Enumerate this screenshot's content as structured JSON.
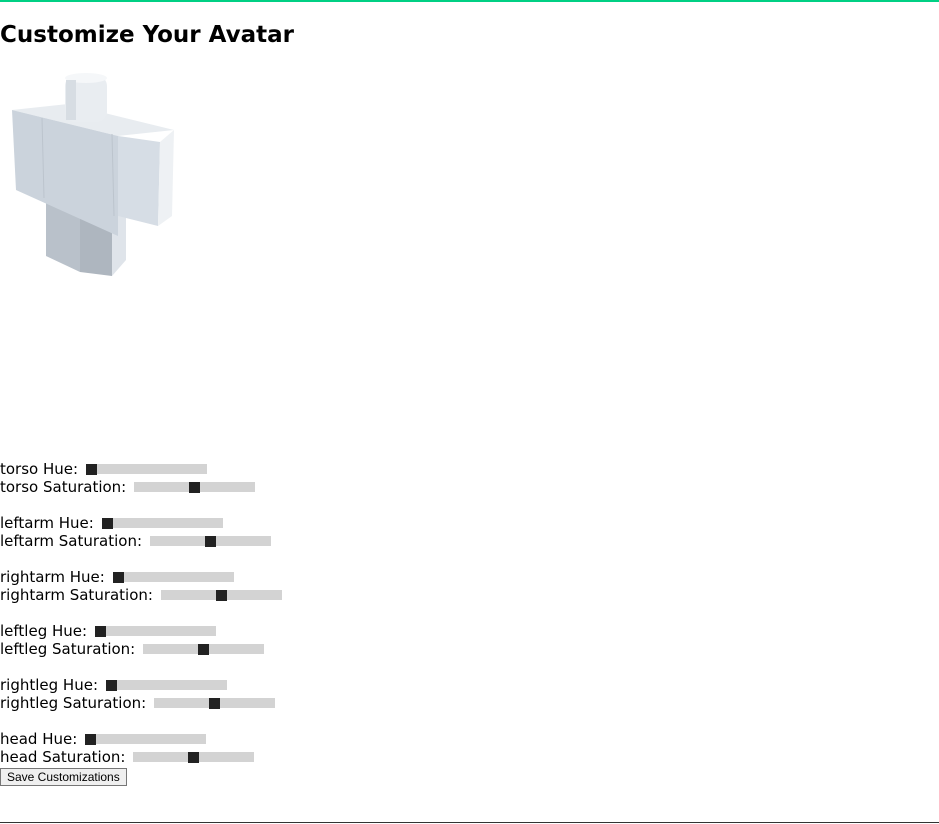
{
  "page": {
    "title": "Customize Your Avatar",
    "accent_color": "#00d084"
  },
  "avatar": {
    "body_color": "#cfd6de"
  },
  "parts": [
    {
      "id": "torso",
      "hue_label": "torso Hue:",
      "sat_label": "torso Saturation:",
      "hue": 0.0,
      "saturation": 0.5
    },
    {
      "id": "leftarm",
      "hue_label": "leftarm Hue:",
      "sat_label": "leftarm Saturation:",
      "hue": 0.0,
      "saturation": 0.5
    },
    {
      "id": "rightarm",
      "hue_label": "rightarm Hue:",
      "sat_label": "rightarm Saturation:",
      "hue": 0.0,
      "saturation": 0.5
    },
    {
      "id": "leftleg",
      "hue_label": "leftleg Hue:",
      "sat_label": "leftleg Saturation:",
      "hue": 0.0,
      "saturation": 0.5
    },
    {
      "id": "rightleg",
      "hue_label": "rightleg Hue:",
      "sat_label": "rightleg Saturation:",
      "hue": 0.0,
      "saturation": 0.5
    },
    {
      "id": "head",
      "hue_label": "head Hue:",
      "sat_label": "head Saturation:",
      "hue": 0.0,
      "saturation": 0.5
    }
  ],
  "save_button": {
    "label": "Save Customizations"
  }
}
